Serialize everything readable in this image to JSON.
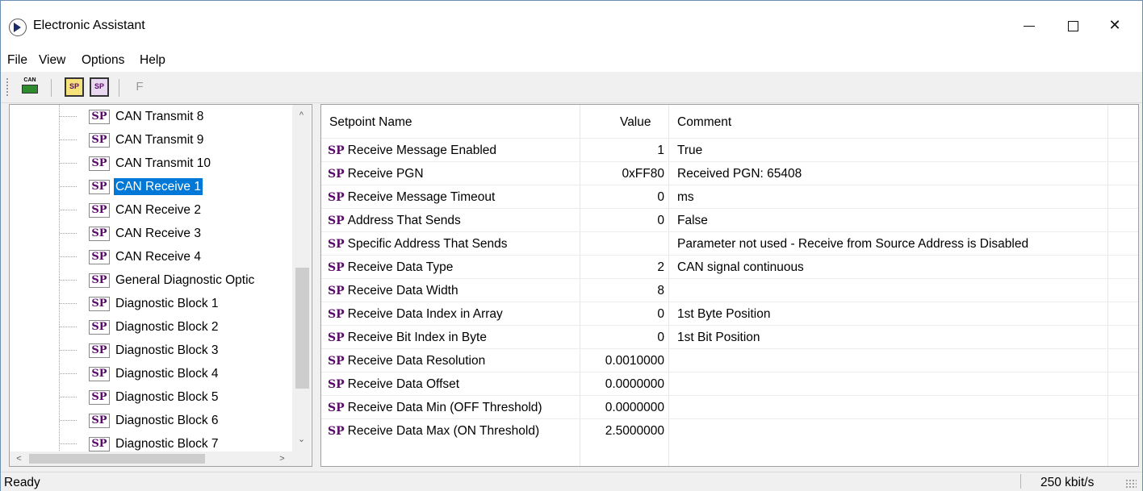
{
  "window": {
    "title": "Electronic Assistant"
  },
  "menu": [
    "File",
    "View",
    "Options",
    "Help"
  ],
  "toolbar": {
    "can_label": "CAN",
    "sp1_label": "SP",
    "sp2_label": "SP",
    "f_label": "F"
  },
  "tree": {
    "icon_label": "SP",
    "items": [
      "CAN Transmit 8",
      "CAN Transmit 9",
      "CAN Transmit 10",
      "CAN Receive 1",
      "CAN Receive 2",
      "CAN Receive 3",
      "CAN Receive 4",
      "General Diagnostic Optic",
      "Diagnostic Block 1",
      "Diagnostic Block 2",
      "Diagnostic Block 3",
      "Diagnostic Block 4",
      "Diagnostic Block 5",
      "Diagnostic Block 6",
      "Diagnostic Block 7"
    ],
    "selected": "CAN Receive 1"
  },
  "grid": {
    "columns": [
      "Setpoint Name",
      "Value",
      "Comment"
    ],
    "row_prefix": "SP",
    "rows": [
      {
        "name": "Receive Message Enabled",
        "value": "1",
        "comment": "True"
      },
      {
        "name": "Receive PGN",
        "value": "0xFF80",
        "comment": "Received PGN: 65408"
      },
      {
        "name": "Receive Message Timeout",
        "value": "0",
        "comment": "ms"
      },
      {
        "name": "Address That Sends",
        "value": "0",
        "comment": "False"
      },
      {
        "name": "Specific Address That Sends",
        "value": "",
        "comment": "Parameter not used - Receive from Source Address is Disabled"
      },
      {
        "name": "Receive Data Type",
        "value": "2",
        "comment": "CAN signal continuous"
      },
      {
        "name": "Receive Data Width",
        "value": "8",
        "comment": ""
      },
      {
        "name": "Receive Data Index in Array",
        "value": "0",
        "comment": "1st Byte Position"
      },
      {
        "name": "Receive Bit Index in Byte",
        "value": "0",
        "comment": "1st Bit Position"
      },
      {
        "name": "Receive Data Resolution",
        "value": "0.0010000",
        "comment": ""
      },
      {
        "name": "Receive Data Offset",
        "value": "0.0000000",
        "comment": ""
      },
      {
        "name": "Receive Data Min (OFF Threshold)",
        "value": "0.0000000",
        "comment": ""
      },
      {
        "name": "Receive Data Max (ON Threshold)",
        "value": "2.5000000",
        "comment": ""
      }
    ]
  },
  "status": {
    "left": "Ready",
    "right": "250 kbit/s"
  }
}
